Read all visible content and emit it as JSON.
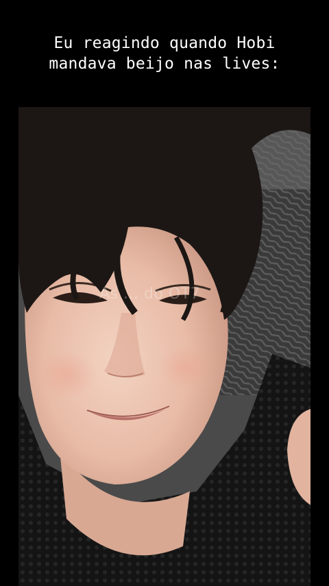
{
  "caption": {
    "line1": "Eu reagindo quando Hobi",
    "line2": "mandava beijo nas lives:"
  },
  "photo": {
    "watermark": "As ... do OT7"
  }
}
